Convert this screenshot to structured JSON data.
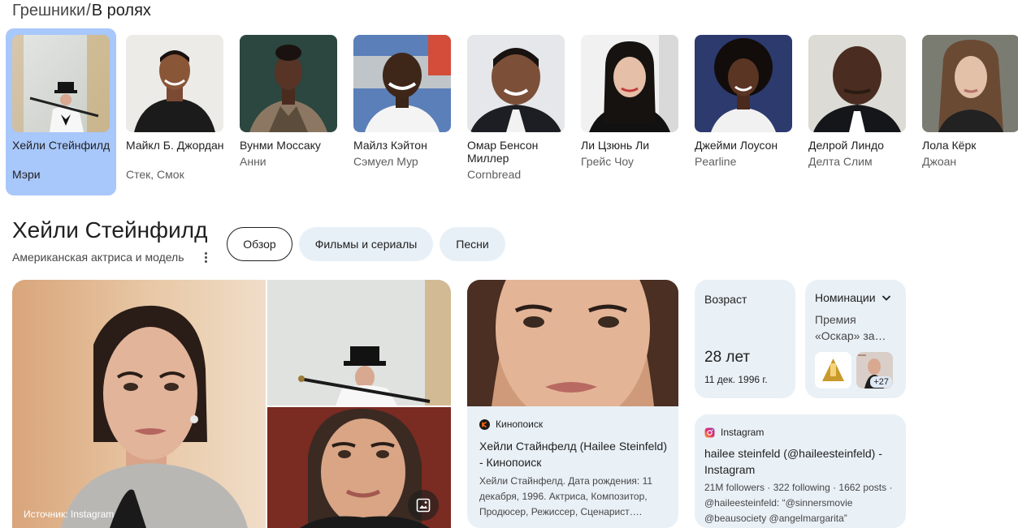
{
  "breadcrumb": {
    "parent": "Грешники",
    "separator": "/",
    "current": "В ролях"
  },
  "cast": [
    {
      "name": "Хейли Стейнфилд",
      "role": "Мэри",
      "selected": true
    },
    {
      "name": "Майкл Б. Джордан",
      "role": "Стек, Смок"
    },
    {
      "name": "Вунми Моссаку",
      "role": "Анни"
    },
    {
      "name": "Майлз Кэйтон",
      "role": "Сэмуел Мур"
    },
    {
      "name": "Омар Бенсон Миллер",
      "role": "Cornbread"
    },
    {
      "name": "Ли Цзюнь Ли",
      "role": "Грейс Чоу"
    },
    {
      "name": "Джейми Лоусон",
      "role": "Pearline"
    },
    {
      "name": "Делрой Линдо",
      "role": "Делта Слим"
    },
    {
      "name": "Лола Кёрк",
      "role": "Джоан"
    }
  ],
  "entity": {
    "title": "Хейли Стейнфилд",
    "subtitle": "Американская актриса и модель"
  },
  "tabs": [
    "Обзор",
    "Фильмы и сериалы",
    "Песни"
  ],
  "images": {
    "source_label": "Источник: Instagram"
  },
  "kinopoisk": {
    "source": "Кинопоиск",
    "title": "Хейли Стайнфелд (Hailee Steinfeld) - Кинопоиск",
    "snippet": "Хейли Стайнфелд. Дата рождения: 11 декабря, 1996. Актриса, Композитор, Продюсер, Режиссер, Сценарист…."
  },
  "age": {
    "label": "Возраст",
    "value": "28 лет",
    "date": "11 дек. 1996 г."
  },
  "nominations": {
    "label": "Номинации",
    "text": "Премия «Оскар» за…",
    "more": "+27"
  },
  "instagram": {
    "source": "Instagram",
    "title": "hailee steinfeld (@haileesteinfeld) - Instagram",
    "snippet": "21M followers · 322 following · 1662 posts · @haileesteinfeld: “@sinnersmovie @beausociety @angelmargarita”"
  },
  "colors": {
    "selected_card": "#a8c7fa",
    "card_bg": "#e9f0f6",
    "chip_bg": "#e8f0f7",
    "text": "#1f1f1f"
  }
}
